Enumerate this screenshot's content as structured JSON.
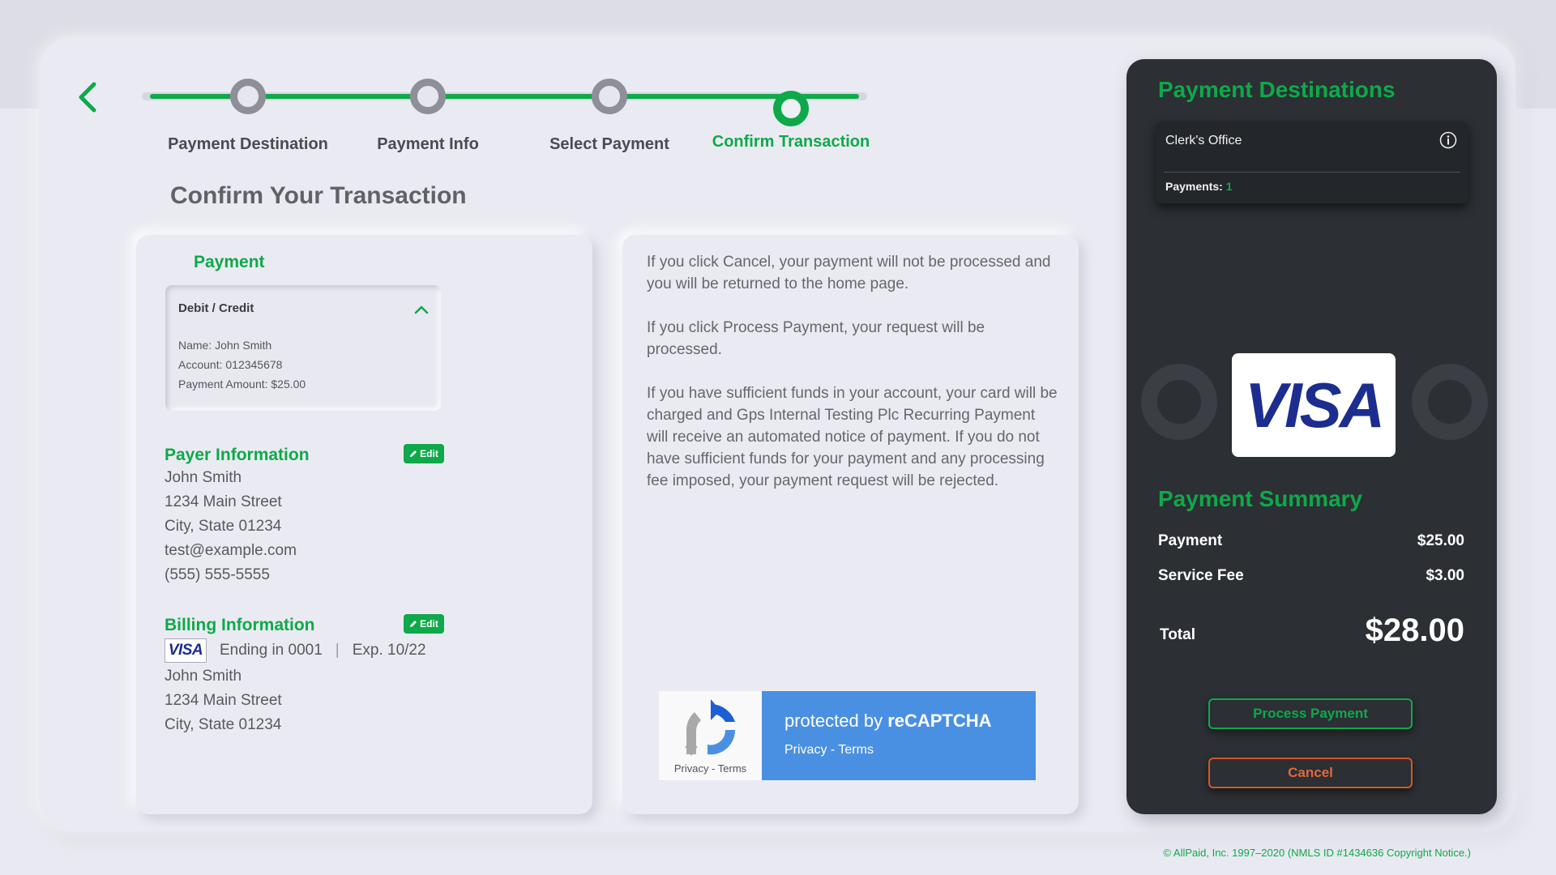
{
  "stepper": {
    "steps": [
      {
        "label": "Payment Destination"
      },
      {
        "label": "Payment Info"
      },
      {
        "label": "Select Payment"
      },
      {
        "label": "Confirm Transaction"
      }
    ],
    "active_index": 3
  },
  "page_title": "Confirm Your Transaction",
  "payment": {
    "title": "Payment",
    "method": "Debit / Credit",
    "name": "Name: John Smith",
    "account": "Account: 012345678",
    "amount": "Payment Amount: $25.00"
  },
  "payer": {
    "title": "Payer Information",
    "edit_label": "Edit",
    "lines": [
      "John Smith",
      "1234 Main Street",
      "City, State 01234",
      "test@example.com",
      "(555) 555-5555"
    ]
  },
  "billing": {
    "title": "Billing Information",
    "edit_label": "Edit",
    "card_brand": "VISA",
    "ending": "Ending in 0001",
    "expiry": "Exp. 10/22",
    "lines": [
      "John Smith",
      "1234 Main Street",
      "City, State 01234"
    ]
  },
  "notice": {
    "p1": "If you click Cancel, your payment will not be processed and you will be returned to the home page.",
    "p2": "If you click Process Payment, your request will be processed.",
    "p3": "If you have sufficient funds in your account, your card will be charged and Gps Internal Testing Plc Recurring Payment will receive an automated notice of payment. If you do not have sufficient funds for your payment and any processing fee imposed, your payment request will be rejected."
  },
  "recaptcha": {
    "protected_prefix": "protected by ",
    "brand": "reCAPTCHA",
    "links": "Privacy - Terms",
    "logo_links": "Privacy - Terms"
  },
  "destinations": {
    "title": "Payment Destinations",
    "item_name": "Clerk's Office",
    "payments_label": "Payments:",
    "payments_count": "1"
  },
  "card_display": {
    "brand": "VISA"
  },
  "summary": {
    "title": "Payment Summary",
    "payment_label": "Payment",
    "payment_value": "$25.00",
    "fee_label": "Service Fee",
    "fee_value": "$3.00",
    "total_label": "Total",
    "total_value": "$28.00"
  },
  "actions": {
    "process_label": "Process Payment",
    "cancel_label": "Cancel"
  },
  "footer": "© AllPaid, Inc. 1997–2020 (NMLS ID #1434636 Copyright Notice.)",
  "colors": {
    "accent": "#0ea94a",
    "cancel": "#e0693b",
    "panel": "#2c2f34",
    "visa_blue": "#1c2d8f",
    "recaptcha_blue": "#4a90e2"
  },
  "icons": [
    "back-arrow-icon",
    "chevron-up-icon",
    "pencil-icon",
    "info-icon",
    "recaptcha-logo-icon"
  ]
}
